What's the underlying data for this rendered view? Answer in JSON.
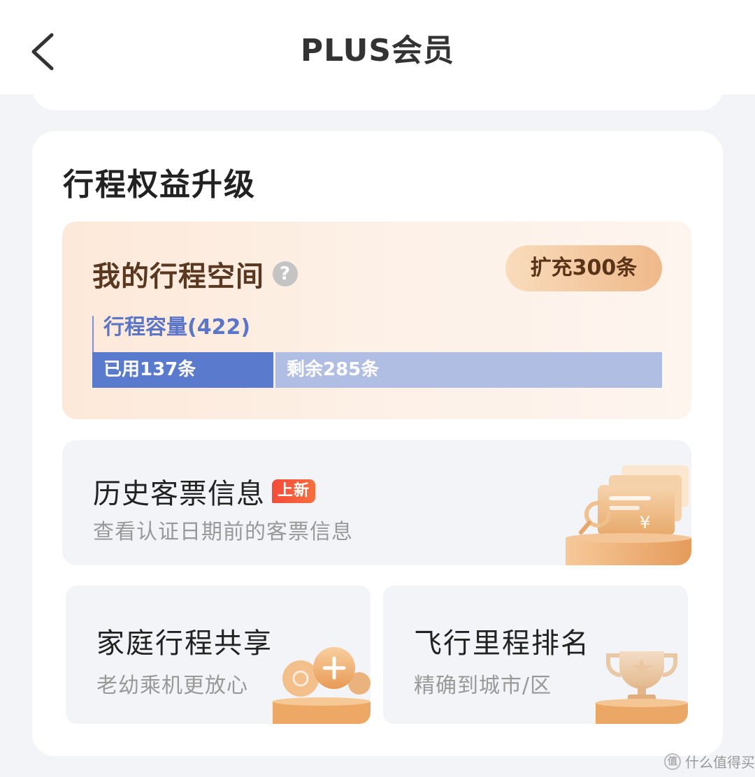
{
  "header": {
    "title": "PLUS会员"
  },
  "section": {
    "title": "行程权益升级"
  },
  "space": {
    "title": "我的行程空间",
    "help_icon_glyph": "?",
    "expand_label": "扩充300条",
    "capacity_label": "行程容量(422)",
    "used_label": "已用137条",
    "remain_label": "剩余285条",
    "used_fraction": 0.3246
  },
  "history": {
    "title": "历史客票信息",
    "badge": "上新",
    "subtitle": "查看认证日期前的客票信息",
    "illustration_icon": "ticket-magnifier-illustration"
  },
  "cards": [
    {
      "title": "家庭行程共享",
      "subtitle": "老幼乘机更放心",
      "illustration_icon": "family-add-illustration"
    },
    {
      "title": "飞行里程排名",
      "subtitle": "精确到城市/区",
      "illustration_icon": "trophy-illustration"
    }
  ],
  "watermark": {
    "text": "什么值得买",
    "logo_glyph": "值"
  },
  "colors": {
    "bar_used": "#5a7bcd",
    "bar_remain": "#b1bee3",
    "badge": "#f4513b",
    "expand_button": "#efb98a",
    "space_card_bg": "#fde9d9"
  }
}
